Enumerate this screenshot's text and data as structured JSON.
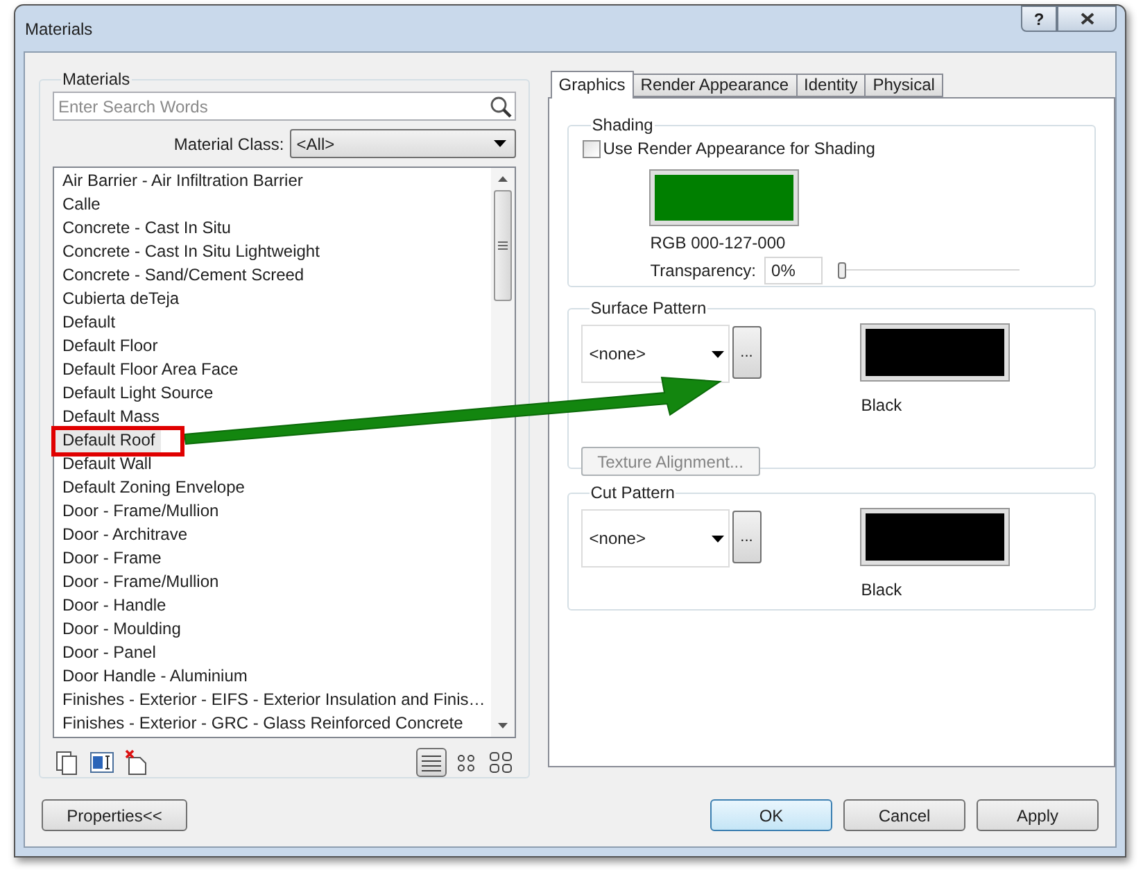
{
  "window": {
    "title": "Materials",
    "help_button": "?"
  },
  "materials_panel": {
    "label": "Materials",
    "search": {
      "placeholder": "Enter Search Words"
    },
    "material_class": {
      "label": "Material Class:",
      "value": "<All>"
    },
    "items": [
      {
        "label": "Air Barrier - Air Infiltration Barrier",
        "selected": false
      },
      {
        "label": "Calle",
        "selected": false
      },
      {
        "label": "Concrete - Cast In Situ",
        "selected": false
      },
      {
        "label": "Concrete - Cast In Situ Lightweight",
        "selected": false
      },
      {
        "label": "Concrete - Sand/Cement Screed",
        "selected": false
      },
      {
        "label": "Cubierta deTeja",
        "selected": false
      },
      {
        "label": "Default",
        "selected": false
      },
      {
        "label": "Default Floor",
        "selected": false
      },
      {
        "label": "Default Floor Area Face",
        "selected": false
      },
      {
        "label": "Default Light Source",
        "selected": false
      },
      {
        "label": "Default Mass",
        "selected": false
      },
      {
        "label": "Default Roof",
        "selected": true
      },
      {
        "label": "Default Wall",
        "selected": false
      },
      {
        "label": "Default Zoning Envelope",
        "selected": false
      },
      {
        "label": "Door -  Frame/Mullion",
        "selected": false
      },
      {
        "label": "Door - Architrave",
        "selected": false
      },
      {
        "label": "Door - Frame",
        "selected": false
      },
      {
        "label": "Door - Frame/Mullion",
        "selected": false
      },
      {
        "label": "Door - Handle",
        "selected": false
      },
      {
        "label": "Door - Moulding",
        "selected": false
      },
      {
        "label": "Door - Panel",
        "selected": false
      },
      {
        "label": "Door Handle - Aluminium",
        "selected": false
      },
      {
        "label": "Finishes - Exterior - EIFS - Exterior Insulation and Finis…",
        "selected": false
      },
      {
        "label": "Finishes - Exterior - GRC -  Glass Reinforced Concrete",
        "selected": false
      }
    ],
    "view_modes": [
      {
        "kind": "list",
        "selected": true
      },
      {
        "kind": "small",
        "selected": false
      },
      {
        "kind": "large",
        "selected": false
      }
    ]
  },
  "tabs": [
    {
      "label": "Graphics",
      "selected": true
    },
    {
      "label": "Render Appearance",
      "selected": false
    },
    {
      "label": "Identity",
      "selected": false
    },
    {
      "label": "Physical",
      "selected": false
    }
  ],
  "shading": {
    "label": "Shading",
    "use_render_appearance": {
      "label": "Use Render Appearance for Shading",
      "checked": false
    },
    "color": "#007f00",
    "rgb": "RGB 000-127-000",
    "transparency": {
      "label": "Transparency:",
      "value": "0%",
      "level": 0
    }
  },
  "surface_pattern": {
    "label": "Surface Pattern",
    "pattern": "<none>",
    "browse": "...",
    "color": "#000000",
    "color_name": "Black",
    "texture_alignment": {
      "label": "Texture Alignment...",
      "disabled": true
    }
  },
  "cut_pattern": {
    "label": "Cut Pattern",
    "pattern": "<none>",
    "browse": "...",
    "color": "#000000",
    "color_name": "Black"
  },
  "buttons": {
    "properties": "Properties<<",
    "ok": "OK",
    "cancel": "Cancel",
    "apply": "Apply"
  }
}
